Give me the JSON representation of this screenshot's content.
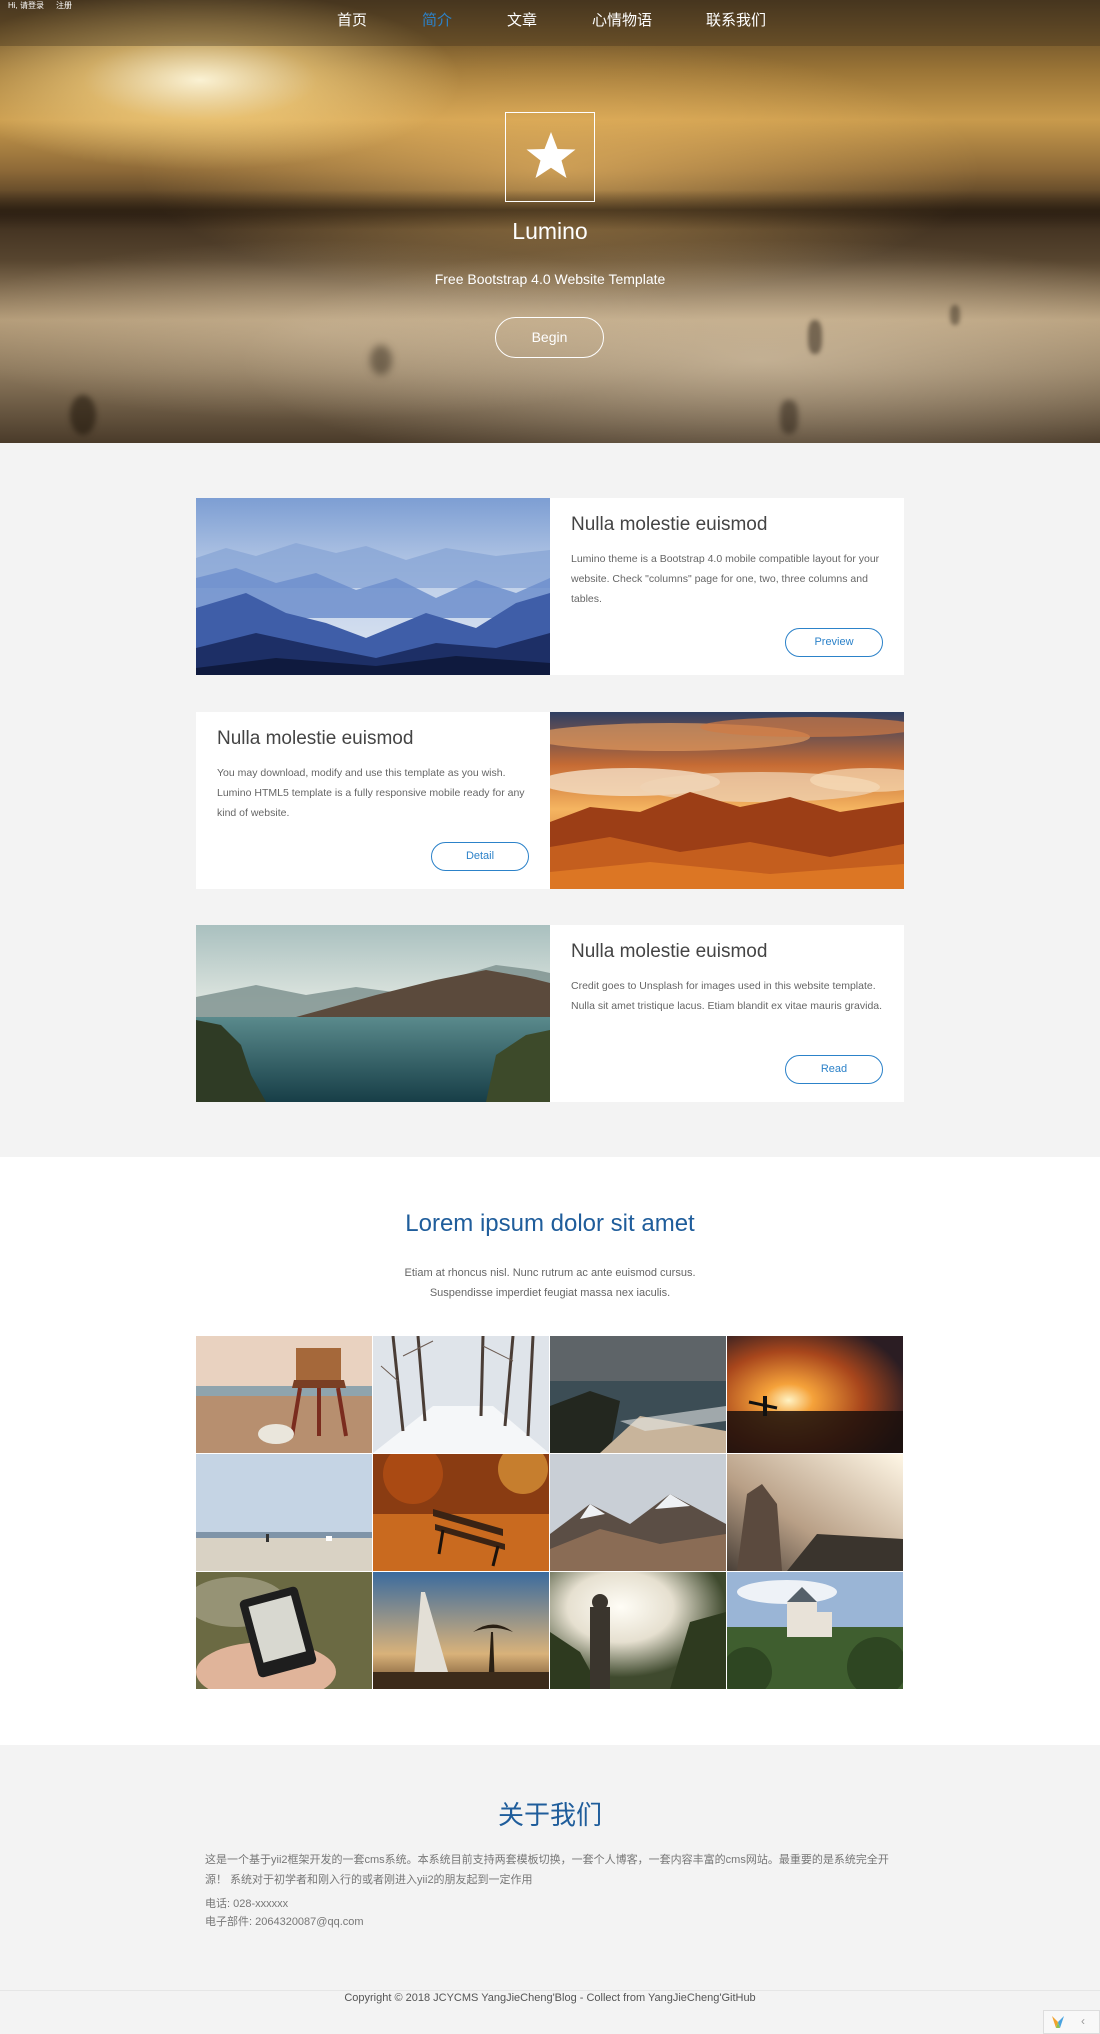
{
  "topbar": {
    "login": "Hi, 请登录",
    "register": "注册"
  },
  "nav": {
    "items": [
      "首页",
      "简介",
      "文章",
      "心情物语",
      "联系我们"
    ],
    "active_index": 1
  },
  "hero": {
    "icon": "star-icon",
    "title": "Lumino",
    "subtitle": "Free Bootstrap 4.0 Website Template",
    "button": "Begin"
  },
  "cards": [
    {
      "title": "Nulla molestie euismod",
      "text": "Lumino theme is a Bootstrap 4.0 mobile compatible layout for your website. Check \"columns\" page for one, two, three columns and tables.",
      "button": "Preview"
    },
    {
      "title": "Nulla molestie euismod",
      "text": "You may download, modify and use this template as you wish. Lumino HTML5 template is a fully responsive mobile ready for any kind of website.",
      "button": "Detail"
    },
    {
      "title": "Nulla molestie euismod",
      "text": "Credit goes to Unsplash for images used in this website template. Nulla sit amet tristique lacus. Etiam blandit ex vitae mauris gravida.",
      "button": "Read"
    }
  ],
  "section": {
    "title": "Lorem ipsum dolor sit amet",
    "line1": "Etiam at rhoncus nisl. Nunc rutrum ac ante euismod cursus.",
    "line2": "Suspendisse imperdiet feugiat massa nex iaculis."
  },
  "about": {
    "title": "关于我们",
    "desc": "这是一个基于yii2框架开发的一套cms系统。本系统目前支持两套模板切换，一套个人博客，一套内容丰富的cms网站。最重要的是系统完全开源！ 系统对于初学者和刚入行的或者刚进入yii2的朋友起到一定作用",
    "phone": "电话: 028-xxxxxx",
    "email": "电子部件: 2064320087@qq.com"
  },
  "footer": {
    "copyright": "Copyright © 2018 JCYCMS YangJieCheng'Blog - Collect from YangJieCheng'GitHub"
  },
  "colors": {
    "accent": "#2c82c9",
    "heading_blue": "#1f5d9b",
    "section_bg": "#f3f3f3"
  }
}
